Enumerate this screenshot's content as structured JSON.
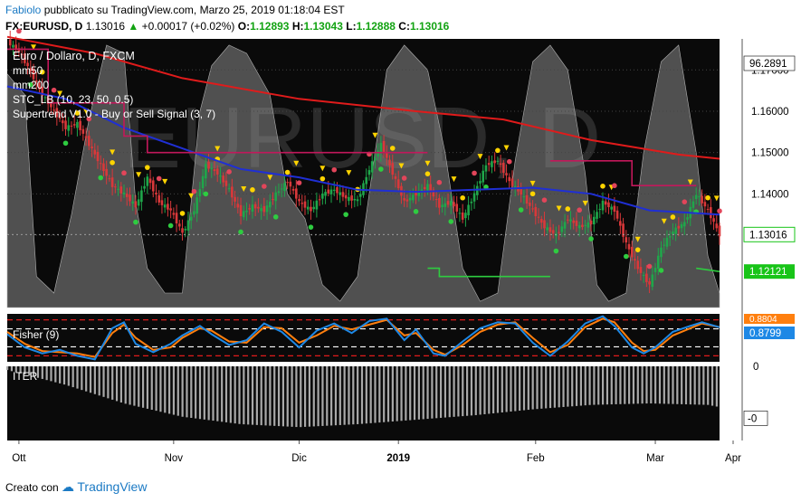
{
  "header": {
    "author": "Fabiolo",
    "published_text": "pubblicato su TradingView.com, Marzo 25, 2019 01:18:04 EST",
    "symbol": "FX:EURUSD, D",
    "last": "1.13016",
    "change": "+0.00017 (+0.02%)",
    "o_label": "O:",
    "o": "1.12893",
    "h_label": "H:",
    "h": "1.13043",
    "l_label": "L:",
    "l": "1.12888",
    "c_label": "C:",
    "c": "1.13016"
  },
  "footer": {
    "prefix": "Creato con",
    "brand": "TradingView"
  },
  "colors": {
    "chart_bg": "#0a0a0a",
    "up_candle": "#1fa64a",
    "down_candle": "#d9383a",
    "ma50": "#1f2fd4",
    "ma200": "#e01b1b",
    "supertrend_up": "#2ecc40",
    "supertrend_down": "#c2185b",
    "stc_area": "#8a8a8a",
    "fisher": "#1e88e5",
    "fisher_trigger": "#ff7f0e",
    "hist": "#a9a9a9",
    "last_price": "#18c418"
  },
  "chart_data": [
    {
      "type": "candlestick",
      "title": "Euro / Dollaro, D, FXCM",
      "legend": [
        "mm50",
        "mm200",
        "STC_LB (10, 23, 50, 0.5)",
        "Supertrend V1.0 - Buy or Sell Signal (3, 7)"
      ],
      "watermark": "EURUSD, D",
      "x_labels": [
        "Ott",
        "Nov",
        "Dic",
        "2019",
        "Feb",
        "Mar",
        "Apr"
      ],
      "y_ticks": [
        1.17,
        1.16,
        1.15,
        1.14,
        1.13
      ],
      "y_labels": [
        "1.17000",
        "1.16000",
        "1.15000",
        "1.14000",
        "1.13016"
      ],
      "ylim": [
        1.1125,
        1.1775
      ],
      "extra_labels": {
        "top": "96.2891",
        "supertrend": "1.12121"
      },
      "close_path": [
        [
          0,
          1.1768
        ],
        [
          4,
          1.1745
        ],
        [
          8,
          1.1695
        ],
        [
          12,
          1.164
        ],
        [
          16,
          1.16
        ],
        [
          20,
          1.156
        ],
        [
          24,
          1.157
        ],
        [
          28,
          1.152
        ],
        [
          32,
          1.147
        ],
        [
          36,
          1.142
        ],
        [
          40,
          1.14
        ],
        [
          44,
          1.137
        ],
        [
          48,
          1.144
        ],
        [
          52,
          1.138
        ],
        [
          56,
          1.136
        ],
        [
          60,
          1.1305
        ],
        [
          64,
          1.136
        ],
        [
          68,
          1.147
        ],
        [
          72,
          1.145
        ],
        [
          76,
          1.141
        ],
        [
          80,
          1.135
        ],
        [
          84,
          1.137
        ],
        [
          88,
          1.136
        ],
        [
          92,
          1.14
        ],
        [
          96,
          1.143
        ],
        [
          100,
          1.138
        ],
        [
          104,
          1.136
        ],
        [
          108,
          1.14
        ],
        [
          112,
          1.141
        ],
        [
          116,
          1.139
        ],
        [
          120,
          1.1385
        ],
        [
          124,
          1.146
        ],
        [
          128,
          1.152
        ],
        [
          132,
          1.145
        ],
        [
          136,
          1.138
        ],
        [
          140,
          1.14
        ],
        [
          144,
          1.142
        ],
        [
          148,
          1.137
        ],
        [
          152,
          1.138
        ],
        [
          156,
          1.134
        ],
        [
          160,
          1.14
        ],
        [
          164,
          1.147
        ],
        [
          168,
          1.148
        ],
        [
          172,
          1.143
        ],
        [
          176,
          1.14
        ],
        [
          180,
          1.136
        ],
        [
          184,
          1.132
        ],
        [
          188,
          1.13
        ],
        [
          192,
          1.134
        ],
        [
          196,
          1.132
        ],
        [
          200,
          1.133
        ],
        [
          204,
          1.138
        ],
        [
          208,
          1.136
        ],
        [
          212,
          1.128
        ],
        [
          216,
          1.122
        ],
        [
          220,
          1.118
        ],
        [
          224,
          1.127
        ],
        [
          228,
          1.131
        ],
        [
          232,
          1.133
        ],
        [
          236,
          1.14
        ],
        [
          240,
          1.136
        ],
        [
          244,
          1.1301
        ]
      ],
      "series": [
        {
          "name": "mm50",
          "points": [
            [
              0,
              1.166
            ],
            [
              20,
              1.163
            ],
            [
              40,
              1.156
            ],
            [
              60,
              1.151
            ],
            [
              80,
              1.146
            ],
            [
              100,
              1.144
            ],
            [
              120,
              1.141
            ],
            [
              140,
              1.1405
            ],
            [
              160,
              1.141
            ],
            [
              180,
              1.1415
            ],
            [
              200,
              1.14
            ],
            [
              220,
              1.136
            ],
            [
              244,
              1.135
            ]
          ]
        },
        {
          "name": "mm200",
          "points": [
            [
              0,
              1.178
            ],
            [
              30,
              1.174
            ],
            [
              60,
              1.168
            ],
            [
              100,
              1.163
            ],
            [
              140,
              1.16
            ],
            [
              170,
              1.158
            ],
            [
              200,
              1.153
            ],
            [
              230,
              1.1495
            ],
            [
              244,
              1.1485
            ]
          ]
        },
        {
          "name": "STC_LB (10, 23, 50, 0.5)",
          "points": [
            [
              0,
              1.169
            ],
            [
              6,
              1.164
            ],
            [
              10,
              1.12
            ],
            [
              16,
              1.116
            ],
            [
              22,
              1.135
            ],
            [
              28,
              1.158
            ],
            [
              34,
              1.176
            ],
            [
              40,
              1.174
            ],
            [
              44,
              1.138
            ],
            [
              48,
              1.122
            ],
            [
              54,
              1.116
            ],
            [
              60,
              1.116
            ],
            [
              66,
              1.16
            ],
            [
              70,
              1.171
            ],
            [
              76,
              1.176
            ],
            [
              82,
              1.174
            ],
            [
              90,
              1.164
            ],
            [
              96,
              1.14
            ],
            [
              102,
              1.134
            ],
            [
              108,
              1.118
            ],
            [
              114,
              1.114
            ],
            [
              120,
              1.12
            ],
            [
              126,
              1.15
            ],
            [
              130,
              1.17
            ],
            [
              136,
              1.176
            ],
            [
              144,
              1.17
            ],
            [
              150,
              1.15
            ],
            [
              156,
              1.122
            ],
            [
              162,
              1.114
            ],
            [
              168,
              1.116
            ],
            [
              174,
              1.148
            ],
            [
              180,
              1.172
            ],
            [
              186,
              1.176
            ],
            [
              192,
              1.17
            ],
            [
              198,
              1.145
            ],
            [
              202,
              1.118
            ],
            [
              206,
              1.114
            ],
            [
              212,
              1.116
            ],
            [
              218,
              1.15
            ],
            [
              224,
              1.172
            ],
            [
              230,
              1.176
            ],
            [
              236,
              1.15
            ],
            [
              240,
              1.125
            ],
            [
              244,
              1.116
            ]
          ]
        },
        {
          "name": "Supertrend V1.0 - Buy or Sell Signal (3, 7)",
          "segments": [
            {
              "trend": "down",
              "points": [
                [
                  0,
                  1.175
                ],
                [
                  14,
                  1.175
                ],
                [
                  14,
                  1.162
                ],
                [
                  40,
                  1.162
                ],
                [
                  40,
                  1.154
                ],
                [
                  48,
                  1.154
                ],
                [
                  48,
                  1.15
                ],
                [
                  144,
                  1.15
                ]
              ]
            },
            {
              "trend": "up",
              "points": [
                [
                  144,
                  1.122
                ],
                [
                  148,
                  1.122
                ],
                [
                  148,
                  1.12
                ],
                [
                  186,
                  1.12
                ]
              ]
            },
            {
              "trend": "down",
              "points": [
                [
                  186,
                  1.148
                ],
                [
                  214,
                  1.148
                ],
                [
                  214,
                  1.142
                ],
                [
                  236,
                  1.142
                ]
              ]
            },
            {
              "trend": "up",
              "points": [
                [
                  236,
                  1.122
                ],
                [
                  244,
                  1.1212
                ]
              ]
            }
          ]
        }
      ]
    },
    {
      "type": "line",
      "name": "Fisher (9)",
      "labels": [
        "0.8804",
        "0.8799"
      ],
      "ylim": [
        -2,
        2
      ],
      "levels": [
        1.5,
        0.75,
        -0.75,
        -1.5
      ],
      "series": [
        {
          "name": "Fisher",
          "points": [
            [
              0,
              0.3
            ],
            [
              6,
              -0.8
            ],
            [
              12,
              -1.3
            ],
            [
              18,
              -1.0
            ],
            [
              24,
              -1.5
            ],
            [
              30,
              -1.8
            ],
            [
              36,
              0.8
            ],
            [
              40,
              1.3
            ],
            [
              44,
              -0.5
            ],
            [
              50,
              -1.2
            ],
            [
              56,
              -0.5
            ],
            [
              60,
              0.2
            ],
            [
              66,
              1.0
            ],
            [
              70,
              0.3
            ],
            [
              76,
              -0.6
            ],
            [
              82,
              -0.2
            ],
            [
              88,
              1.2
            ],
            [
              94,
              0.5
            ],
            [
              100,
              -0.8
            ],
            [
              106,
              0.6
            ],
            [
              112,
              1.2
            ],
            [
              118,
              0.4
            ],
            [
              124,
              1.4
            ],
            [
              130,
              1.6
            ],
            [
              136,
              -0.2
            ],
            [
              140,
              0.7
            ],
            [
              146,
              -1.3
            ],
            [
              150,
              -1.5
            ],
            [
              156,
              -0.3
            ],
            [
              162,
              0.8
            ],
            [
              168,
              1.3
            ],
            [
              174,
              1.2
            ],
            [
              180,
              -0.4
            ],
            [
              186,
              -1.5
            ],
            [
              192,
              -0.3
            ],
            [
              198,
              1.2
            ],
            [
              204,
              1.8
            ],
            [
              208,
              1.0
            ],
            [
              214,
              -0.8
            ],
            [
              218,
              -1.3
            ],
            [
              222,
              -0.8
            ],
            [
              228,
              0.5
            ],
            [
              234,
              1.0
            ],
            [
              238,
              1.3
            ],
            [
              244,
              0.88
            ]
          ]
        },
        {
          "name": "Trigger",
          "points": [
            [
              0,
              0.5
            ],
            [
              6,
              -0.5
            ],
            [
              12,
              -1.1
            ],
            [
              18,
              -1.2
            ],
            [
              24,
              -1.3
            ],
            [
              30,
              -1.6
            ],
            [
              36,
              0.4
            ],
            [
              40,
              1.1
            ],
            [
              44,
              0.0
            ],
            [
              50,
              -1.0
            ],
            [
              56,
              -0.8
            ],
            [
              60,
              0.0
            ],
            [
              66,
              0.8
            ],
            [
              70,
              0.6
            ],
            [
              76,
              -0.3
            ],
            [
              82,
              -0.4
            ],
            [
              88,
              0.9
            ],
            [
              94,
              0.8
            ],
            [
              100,
              -0.4
            ],
            [
              106,
              0.2
            ],
            [
              112,
              1.0
            ],
            [
              118,
              0.7
            ],
            [
              124,
              1.1
            ],
            [
              130,
              1.5
            ],
            [
              136,
              0.2
            ],
            [
              140,
              0.4
            ],
            [
              146,
              -1.0
            ],
            [
              150,
              -1.4
            ],
            [
              156,
              -0.6
            ],
            [
              162,
              0.5
            ],
            [
              168,
              1.1
            ],
            [
              174,
              1.3
            ],
            [
              180,
              0.0
            ],
            [
              186,
              -1.2
            ],
            [
              192,
              -0.6
            ],
            [
              198,
              0.9
            ],
            [
              204,
              1.6
            ],
            [
              208,
              1.3
            ],
            [
              214,
              -0.4
            ],
            [
              218,
              -1.1
            ],
            [
              222,
              -1.0
            ],
            [
              228,
              0.2
            ],
            [
              234,
              0.8
            ],
            [
              238,
              1.2
            ],
            [
              244,
              0.9
            ]
          ]
        }
      ]
    },
    {
      "type": "bar",
      "name": "ITER",
      "labels": [
        "0",
        "-0"
      ],
      "ylim": [
        -1,
        0
      ],
      "values_env": [
        [
          0,
          -0.05
        ],
        [
          20,
          -0.25
        ],
        [
          40,
          -0.5
        ],
        [
          60,
          -0.68
        ],
        [
          80,
          -0.78
        ],
        [
          100,
          -0.82
        ],
        [
          120,
          -0.78
        ],
        [
          140,
          -0.72
        ],
        [
          160,
          -0.66
        ],
        [
          180,
          -0.58
        ],
        [
          200,
          -0.52
        ],
        [
          220,
          -0.5
        ],
        [
          240,
          -0.52
        ],
        [
          244,
          -0.55
        ]
      ]
    }
  ]
}
